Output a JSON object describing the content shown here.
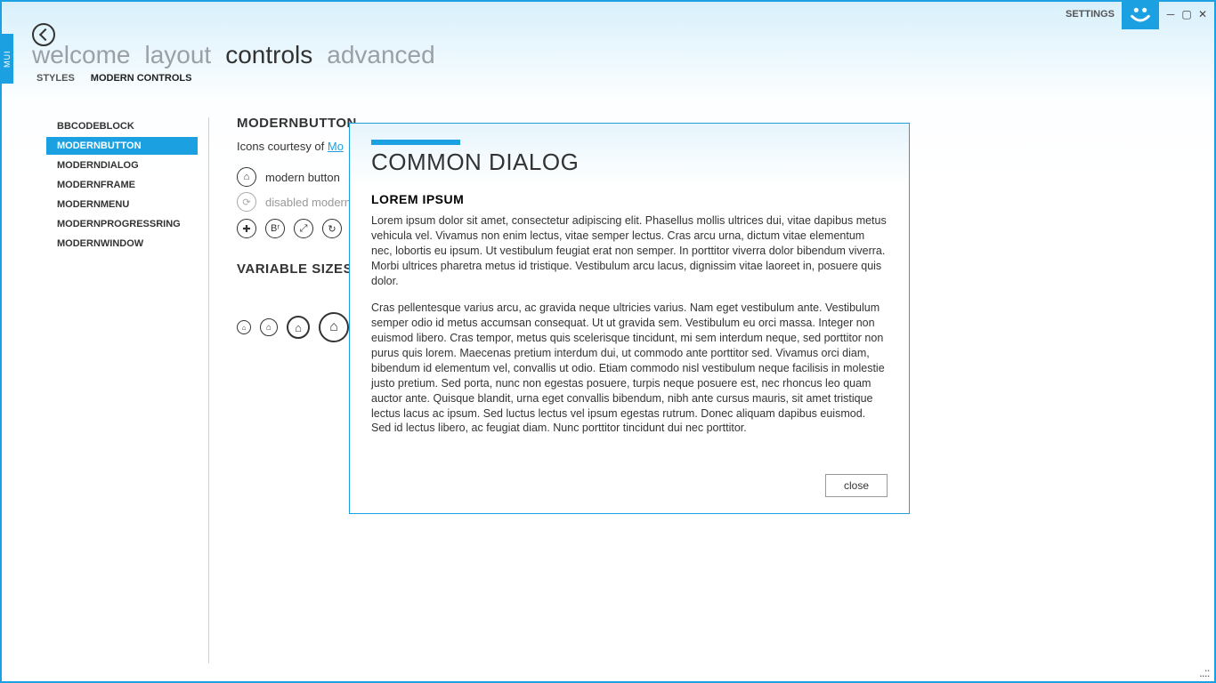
{
  "badge": "MUI",
  "titlebar": {
    "settings": "SETTINGS",
    "logo_glyph": "☻",
    "min": "─",
    "restore": "▢",
    "close": "✕"
  },
  "nav": {
    "items": [
      "welcome",
      "layout",
      "controls",
      "advanced"
    ],
    "active_index": 2
  },
  "subnav": {
    "items": [
      "STYLES",
      "MODERN CONTROLS"
    ],
    "active_index": 1
  },
  "sidebar": {
    "items": [
      "BBCODEBLOCK",
      "MODERNBUTTON",
      "MODERNDIALOG",
      "MODERNFRAME",
      "MODERNMENU",
      "MODERNPROGRESSRING",
      "MODERNWINDOW"
    ],
    "selected_index": 1
  },
  "content": {
    "heading1": "MODERNBUTTON",
    "credits_prefix": "Icons courtesy of ",
    "credits_link": "Mo",
    "row1_label": "modern button",
    "row2_label": "disabled modern",
    "heading2": "VARIABLE SIZES",
    "icon_add": "✚",
    "icon_br": "Bʳ",
    "icon_expand": "⤢",
    "icon_redo": "↻",
    "icon_more": "‹",
    "icon_home": "⌂",
    "icon_refresh": "⟳"
  },
  "dialog": {
    "title": "COMMON DIALOG",
    "subtitle": "LOREM IPSUM",
    "p1": "Lorem ipsum dolor sit amet, consectetur adipiscing elit. Phasellus mollis ultrices dui, vitae dapibus metus vehicula vel. Vivamus non enim lectus, vitae semper lectus. Cras arcu urna, dictum vitae elementum nec, lobortis eu ipsum. Ut vestibulum feugiat erat non semper. In porttitor viverra dolor bibendum viverra. Morbi ultrices pharetra metus id tristique. Vestibulum arcu lacus, dignissim vitae laoreet in, posuere quis dolor.",
    "p2": "Cras pellentesque varius arcu, ac gravida neque ultricies varius. Nam eget vestibulum ante. Vestibulum semper odio id metus accumsan consequat. Ut ut gravida sem. Vestibulum eu orci massa. Integer non euismod libero. Cras tempor, metus quis scelerisque tincidunt, mi sem interdum neque, sed porttitor non purus quis lorem. Maecenas pretium interdum dui, ut commodo ante porttitor sed. Vivamus orci diam, bibendum id elementum vel, convallis ut odio. Etiam commodo nisl vestibulum neque facilisis in molestie justo pretium. Sed porta, nunc non egestas posuere, turpis neque posuere est, nec rhoncus leo quam auctor ante. Quisque blandit, urna eget convallis bibendum, nibh ante cursus mauris, sit amet tristique lectus lacus ac ipsum. Sed luctus lectus vel ipsum egestas rutrum. Donec aliquam dapibus euismod. Sed id lectus libero, ac feugiat diam. Nunc porttitor tincidunt dui nec porttitor.",
    "close_label": "close"
  },
  "grip": "..::"
}
